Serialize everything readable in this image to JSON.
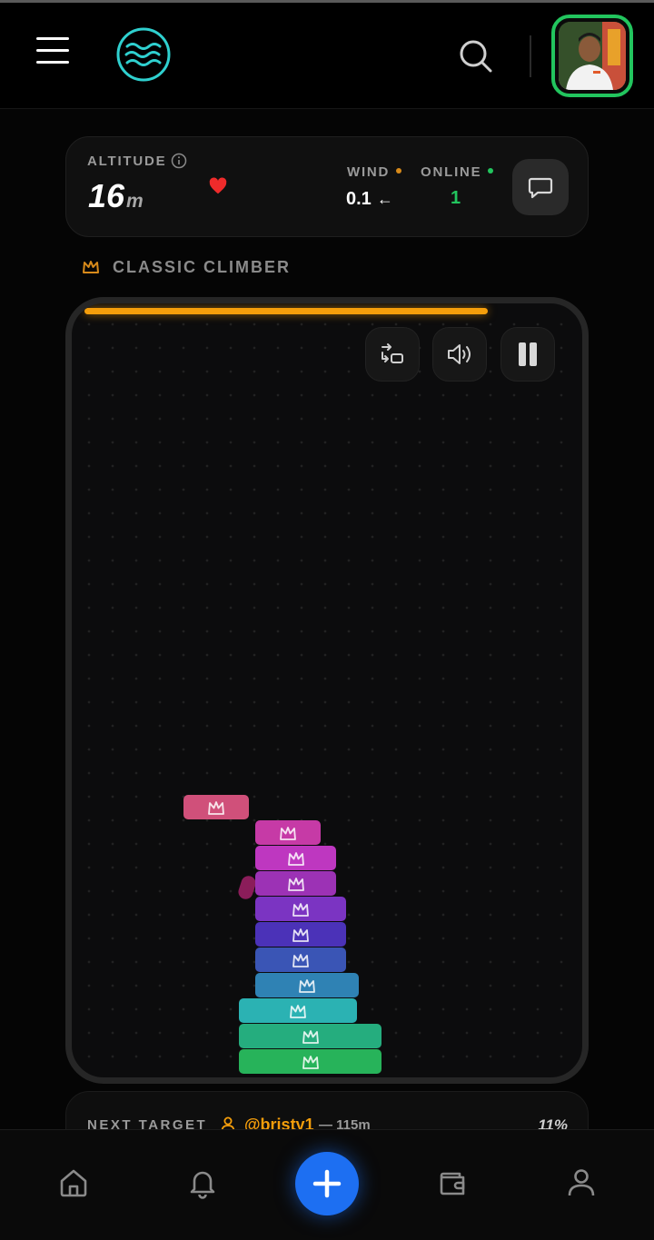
{
  "header": {
    "menu_icon": "hamburger-menu-icon",
    "logo_icon": "waves-logo-icon",
    "search_icon": "search-icon",
    "avatar_icon": "user-avatar"
  },
  "stats": {
    "altitude_label": "ALTITUDE",
    "altitude_value": "16",
    "altitude_unit": "m",
    "wind_label": "WIND",
    "wind_value": "0.1",
    "wind_arrow": "←",
    "online_label": "ONLINE",
    "online_value": "1",
    "colors": {
      "wind_dot": "#d88a1a",
      "online_dot": "#22c55e",
      "heart": "#ef2b2b",
      "online_value": "#22c55e"
    }
  },
  "mode": {
    "icon": "crown-icon",
    "label": "CLASSIC CLIMBER"
  },
  "game": {
    "progress": 0.82,
    "progress_color": "#f59e0b",
    "controls": [
      "swap-icon",
      "volume-icon",
      "pause-icon"
    ],
    "block_icon": "crown-icon",
    "blocks": [
      {
        "color": "#d0507a"
      },
      {
        "color": "#c63aa6"
      },
      {
        "color": "#be37c0"
      },
      {
        "color": "#9c32b5"
      },
      {
        "color": "#7b34c2"
      },
      {
        "color": "#4b32b8"
      },
      {
        "color": "#3a55b5"
      },
      {
        "color": "#2f82b4"
      },
      {
        "color": "#2bb2b3"
      },
      {
        "color": "#25ad7e"
      },
      {
        "color": "#27b35a"
      }
    ]
  },
  "target": {
    "label": "NEXT TARGET",
    "user": "@bristy1",
    "distance": "— 115m",
    "percent": "11%"
  },
  "nav": {
    "items": [
      "home-icon",
      "bell-icon",
      "add-icon",
      "wallet-icon",
      "profile-icon"
    ],
    "accent": "#1d6ff2"
  }
}
